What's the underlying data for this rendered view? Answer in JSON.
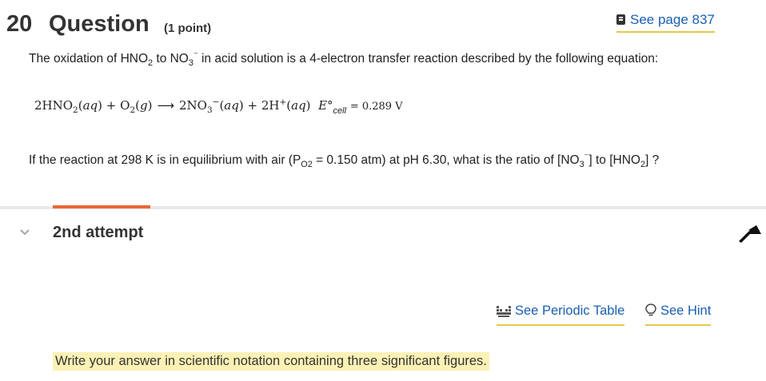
{
  "question": {
    "number": "20",
    "word": "Question",
    "points": "(1 point)",
    "see_page": "See page 837",
    "intro_parts": [
      "The oxidation of HNO",
      "2",
      " to NO",
      "3",
      "⁻",
      " in acid solution is a 4-electron transfer reaction described by the following equation:"
    ],
    "equation": {
      "lhs_a": "2HNO",
      "lhs_a_sub": "2",
      "lhs_a_state": "aq",
      "plus1": "+",
      "lhs_b": "O",
      "lhs_b_sub": "2",
      "lhs_b_state": "g",
      "arrow": "⟶",
      "rhs_a": "2NO",
      "rhs_a_sub": "3",
      "rhs_a_sup": "−",
      "rhs_a_state": "aq",
      "plus2": "+",
      "rhs_b": "2H",
      "rhs_b_sup": "+",
      "rhs_b_state": "aq",
      "e_symbol": "E°",
      "e_sub": "cell",
      "e_value": "= 0.289 V"
    },
    "question_parts": [
      "If the reaction at 298 K is in equilibrium with air (P",
      "O2",
      " = 0.150 atm) at pH 6.30, what is the ratio of [NO",
      "3",
      "⁻",
      "] to [HNO",
      "2",
      "] ?"
    ]
  },
  "attempt": {
    "label": "2nd attempt"
  },
  "tools": {
    "periodic_table": "See Periodic Table",
    "hint": "See Hint"
  },
  "answer_prompt": "Write your answer in scientific notation containing three significant figures.",
  "colors": {
    "link": "#1a5fb4",
    "underline": "#e6c84a",
    "progress": "#e8673a",
    "highlight": "#fbf1b5"
  },
  "icons": [
    "book-icon",
    "chevron-down-icon",
    "flag-icon",
    "periodic-table-icon",
    "lightbulb-icon"
  ]
}
